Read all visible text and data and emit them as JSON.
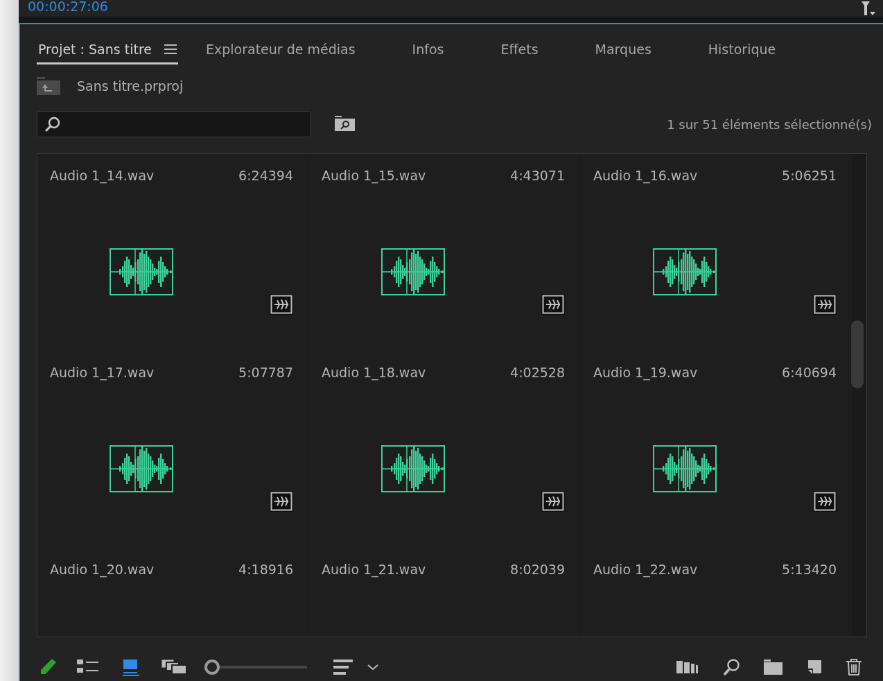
{
  "timecode": "00:00:27:06",
  "tabs": [
    {
      "label": "Projet : Sans titre",
      "selected": true,
      "menu": true
    },
    {
      "label": "Explorateur de médias",
      "selected": false,
      "menu": false
    },
    {
      "label": "Infos",
      "selected": false,
      "menu": false
    },
    {
      "label": "Effets",
      "selected": false,
      "menu": false
    },
    {
      "label": "Marques",
      "selected": false,
      "menu": false
    },
    {
      "label": "Historique",
      "selected": false,
      "menu": false
    }
  ],
  "project_file": "Sans titre.prproj",
  "selection_count": "1 sur 51 éléments sélectionné(s)",
  "items": [
    {
      "name": "Audio 1_14.wav",
      "duration": "6:24394"
    },
    {
      "name": "Audio 1_15.wav",
      "duration": "4:43071"
    },
    {
      "name": "Audio 1_16.wav",
      "duration": "5:06251"
    },
    {
      "name": "Audio 1_17.wav",
      "duration": "5:07787"
    },
    {
      "name": "Audio 1_18.wav",
      "duration": "4:02528"
    },
    {
      "name": "Audio 1_19.wav",
      "duration": "6:40694"
    },
    {
      "name": "Audio 1_20.wav",
      "duration": "4:18916"
    },
    {
      "name": "Audio 1_21.wav",
      "duration": "8:02039"
    },
    {
      "name": "Audio 1_22.wav",
      "duration": "5:13420"
    }
  ],
  "view_modes": [
    {
      "kind": "list",
      "selected": false
    },
    {
      "kind": "icon",
      "selected": true
    },
    {
      "kind": "freeform",
      "selected": false
    }
  ],
  "zoom": {
    "level": 0.0
  }
}
